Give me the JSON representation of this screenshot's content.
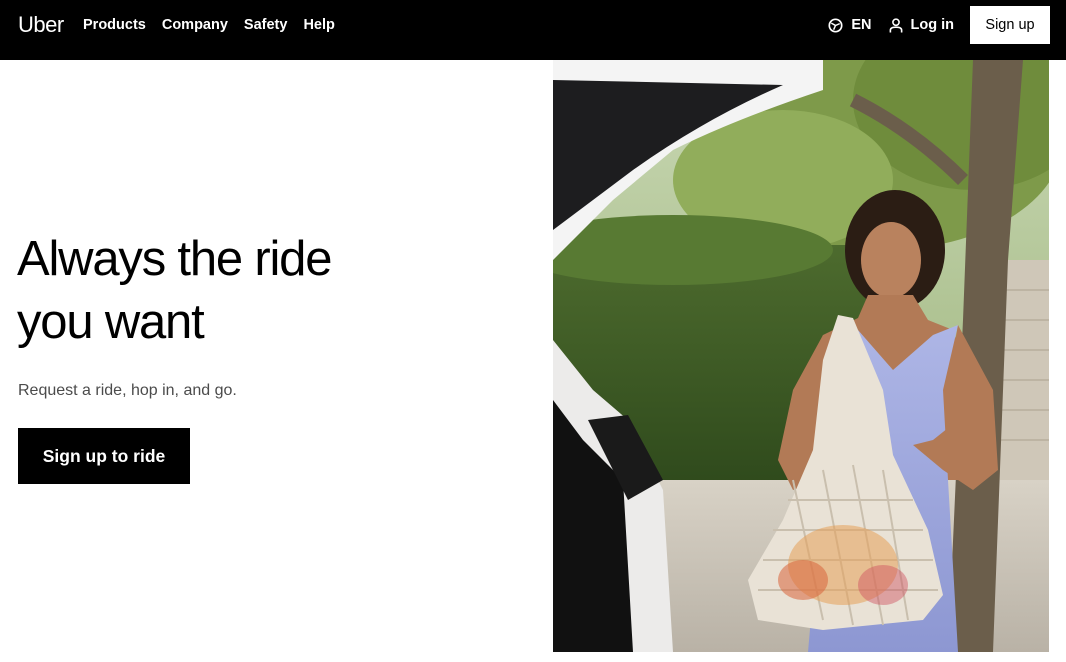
{
  "header": {
    "logo": "Uber",
    "nav": [
      "Products",
      "Company",
      "Safety",
      "Help"
    ],
    "language": "EN",
    "login": "Log in",
    "signup": "Sign up"
  },
  "hero": {
    "title_line1": "Always the ride",
    "title_line2": "you want",
    "subtitle": "Request a ride, hop in, and go.",
    "cta": "Sign up to ride"
  },
  "colors": {
    "nav_bg": "#000000",
    "primary_button": "#000000"
  }
}
